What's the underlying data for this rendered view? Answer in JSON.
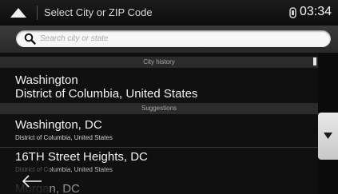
{
  "header": {
    "title": "Select City or ZIP Code",
    "clock": "03:34"
  },
  "search": {
    "placeholder": "Search city or state",
    "value": ""
  },
  "sections": {
    "history_label": "City history",
    "suggestions_label": "Suggestions"
  },
  "history": [
    {
      "title": "Washington",
      "subtitle": "District of Columbia, United States"
    }
  ],
  "suggestions": [
    {
      "title": "Washington, DC",
      "subtitle": "District of Columbia, United States"
    },
    {
      "title": "16TH Street Heights, DC",
      "subtitle": "District of Columbia, United States"
    },
    {
      "title": "Morgan, DC",
      "subtitle": ""
    }
  ],
  "icons": {
    "up": "up-arrow-icon",
    "gps": "gps-signal-icon",
    "search": "search-icon",
    "scroll_down": "triangle-down-icon",
    "back": "back-arrow-icon"
  },
  "colors": {
    "background": "#101010",
    "header": "#2b2b2b",
    "text": "#f2f2f2"
  }
}
